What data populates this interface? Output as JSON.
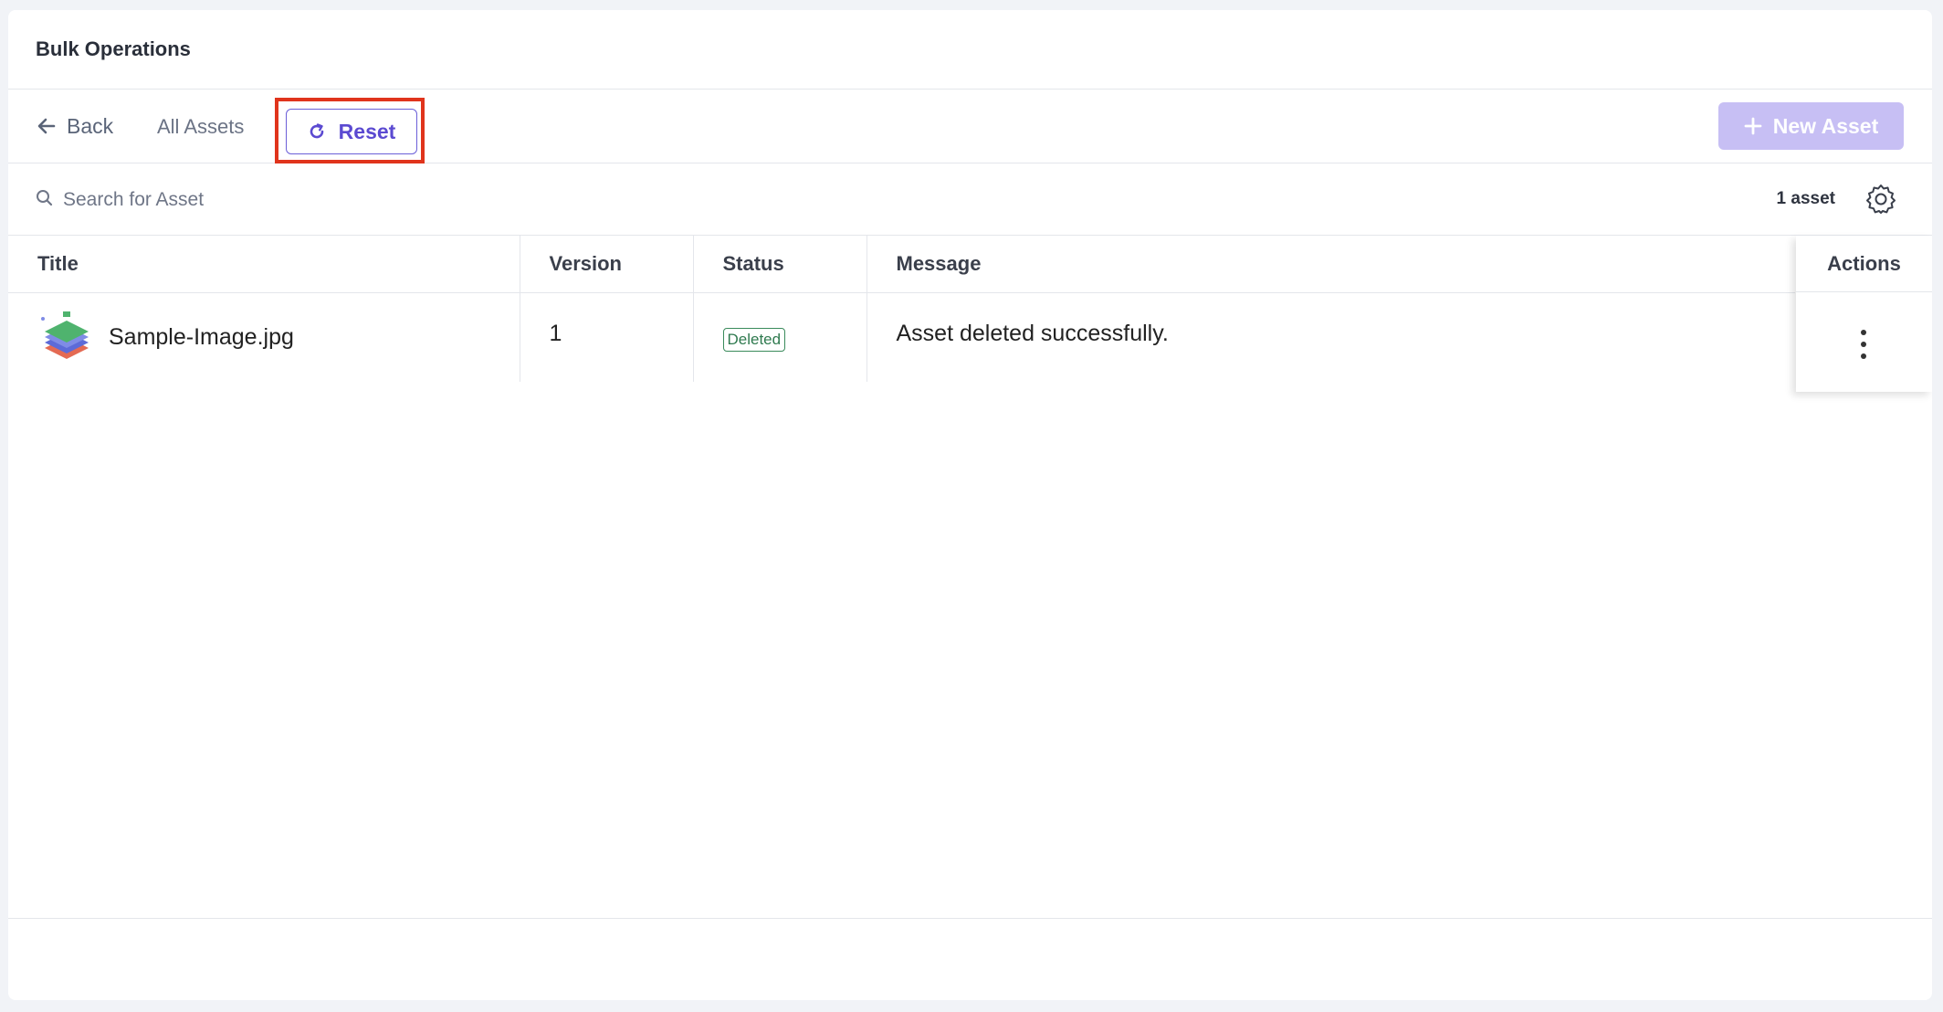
{
  "header": {
    "title": "Bulk Operations"
  },
  "toolbar": {
    "back_label": "Back",
    "all_assets_label": "All Assets",
    "reset_label": "Reset",
    "new_asset_label": "New Asset"
  },
  "search": {
    "placeholder": "Search for Asset",
    "value": "",
    "count_label": "1 asset"
  },
  "table": {
    "columns": [
      "Title",
      "Version",
      "Status",
      "Message",
      "Actions"
    ],
    "rows": [
      {
        "title": "Sample-Image.jpg",
        "version": "1",
        "status": "Deleted",
        "message": "Asset deleted successfully."
      }
    ]
  },
  "icons": {
    "back": "arrow-left-icon",
    "reset": "refresh-icon",
    "new_asset": "plus-icon",
    "search": "search-icon",
    "settings": "gear-icon",
    "row_actions": "kebab-menu-icon"
  },
  "colors": {
    "accent": "#5b4ad1",
    "primary_disabled": "#c7bff4",
    "status_success": "#2f7a4f",
    "highlight": "#e0341c"
  }
}
